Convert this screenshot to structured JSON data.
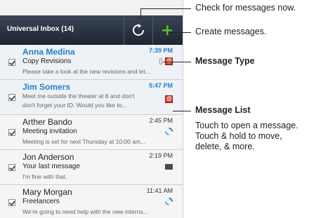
{
  "header": {
    "title": "Universal Inbox (14)"
  },
  "messages": [
    {
      "sender": "Anna Medina",
      "time": "7:39 PM",
      "subject": "Copy Revisions",
      "preview": "Please take a look at the new revisions and let...",
      "unread": true,
      "type_icon": "email-icon"
    },
    {
      "sender": "Jim Somers",
      "time": "5:47 PM",
      "subject": "",
      "preview": "Meet me outside the theater at 8 and don't",
      "preview2": "don't forget your ID. Would you like to...",
      "unread": true,
      "type_icon": "email-icon"
    },
    {
      "sender": "Arther Bando",
      "time": "2:45 PM",
      "subject": "Meeting invitation",
      "preview": "Meeting is set for next Thursday at 10:00 am...",
      "unread": false,
      "type_icon": "sync-icon"
    },
    {
      "sender": "Jon Anderson",
      "time": "2:19 PM",
      "subject": "Your last message",
      "preview": "I'm fine with that.",
      "unread": false,
      "type_icon": "envelope-icon"
    },
    {
      "sender": "Mary Morgan",
      "time": "11:41 AM",
      "subject": "Freelancers",
      "preview": "We're going to need help with the new interns...",
      "unread": false,
      "type_icon": "sync-icon"
    }
  ],
  "callouts": {
    "check": "Check for messages now.",
    "create": "Create messages.",
    "message_type": "Message Type",
    "message_list": "Message List",
    "desc1": "Touch to open a message.",
    "desc2": "Touch & hold to move,",
    "desc3": "delete, & more."
  },
  "colors": {
    "accent": "#1f7fd1",
    "header_bg": "#2b3340",
    "create_plus": "#5cc22b"
  }
}
